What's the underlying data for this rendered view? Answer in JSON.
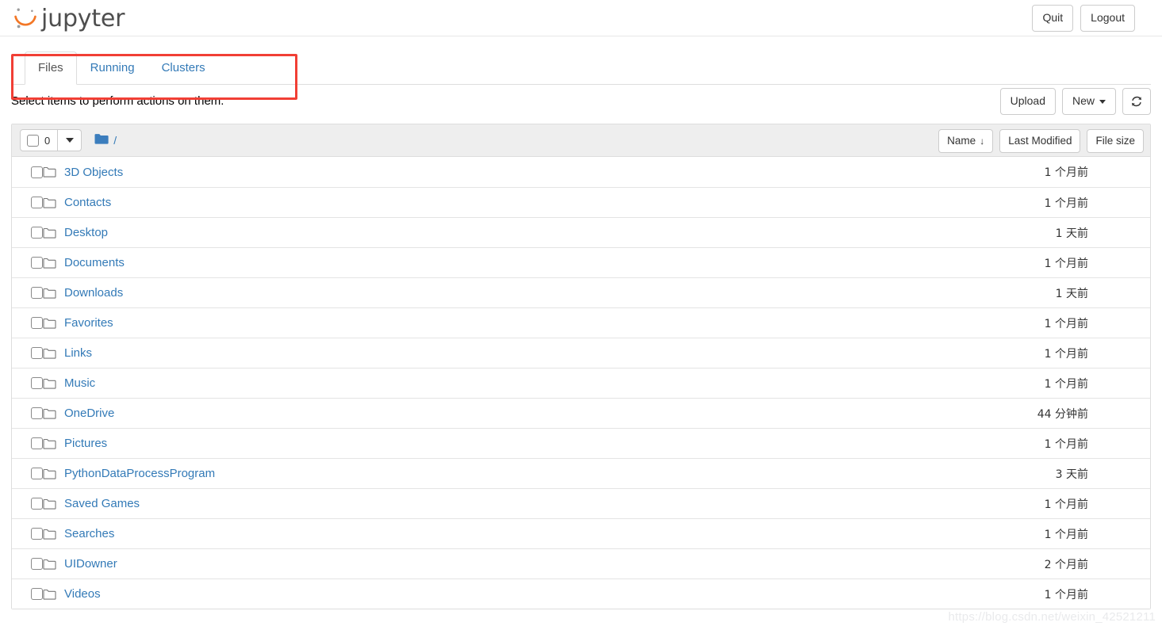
{
  "brand": {
    "name": "jupyter",
    "logo_icon": "jupyter-logo-icon"
  },
  "header": {
    "quit_label": "Quit",
    "logout_label": "Logout"
  },
  "tabs": [
    {
      "label": "Files",
      "active": true
    },
    {
      "label": "Running",
      "active": false
    },
    {
      "label": "Clusters",
      "active": false
    }
  ],
  "annotation": {
    "color": "#f13f35",
    "target": "tab-bar"
  },
  "notice": "Select items to perform actions on them.",
  "actions": {
    "upload_label": "Upload",
    "new_label": "New",
    "refresh_icon": "refresh-icon"
  },
  "list_header": {
    "select_count": "0",
    "breadcrumb_root": "/",
    "folder_icon": "folder-filled-icon",
    "sort": {
      "name_label": "Name",
      "name_arrow": "↓",
      "last_modified_label": "Last Modified",
      "file_size_label": "File size"
    }
  },
  "colors": {
    "link": "#337ab7",
    "header_bg": "#eeeeee",
    "annotation": "#f13f35",
    "folder_blue": "#337ab7",
    "logo_orange": "#f37726"
  },
  "items": [
    {
      "name": "3D Objects",
      "modified": "1 个月前",
      "size": ""
    },
    {
      "name": "Contacts",
      "modified": "1 个月前",
      "size": ""
    },
    {
      "name": "Desktop",
      "modified": "1 天前",
      "size": ""
    },
    {
      "name": "Documents",
      "modified": "1 个月前",
      "size": ""
    },
    {
      "name": "Downloads",
      "modified": "1 天前",
      "size": ""
    },
    {
      "name": "Favorites",
      "modified": "1 个月前",
      "size": ""
    },
    {
      "name": "Links",
      "modified": "1 个月前",
      "size": ""
    },
    {
      "name": "Music",
      "modified": "1 个月前",
      "size": ""
    },
    {
      "name": "OneDrive",
      "modified": "44 分钟前",
      "size": ""
    },
    {
      "name": "Pictures",
      "modified": "1 个月前",
      "size": ""
    },
    {
      "name": "PythonDataProcessProgram",
      "modified": "3 天前",
      "size": ""
    },
    {
      "name": "Saved Games",
      "modified": "1 个月前",
      "size": ""
    },
    {
      "name": "Searches",
      "modified": "1 个月前",
      "size": ""
    },
    {
      "name": "UIDowner",
      "modified": "2 个月前",
      "size": ""
    },
    {
      "name": "Videos",
      "modified": "1 个月前",
      "size": ""
    }
  ],
  "watermark": "https://blog.csdn.net/weixin_42521211"
}
